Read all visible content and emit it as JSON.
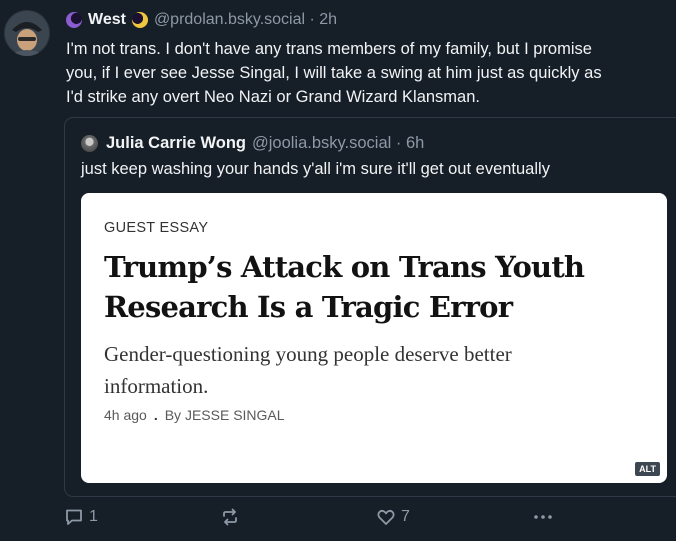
{
  "post": {
    "display_name": "West",
    "handle": "@prdolan.bsky.social",
    "time": "2h",
    "text_lines": [
      "I'm not trans. I don't have any trans members of my family, but I promise",
      "you, if I ever see Jesse Singal, I will take a swing at him just as quickly as",
      "I'd strike any overt Neo Nazi or Grand Wizard Klansman."
    ]
  },
  "quote": {
    "display_name": "Julia Carrie Wong",
    "handle": "@joolia.bsky.social",
    "time": "6h",
    "text": "just keep washing your hands y'all i'm sure it'll get out eventually"
  },
  "article": {
    "kicker": "GUEST ESSAY",
    "headline_lines": [
      "Trump’s Attack on Trans Youth",
      "Research Is a Tragic Error"
    ],
    "summary_lines": [
      "Gender-questioning young people deserve better",
      "information."
    ],
    "time": "4h ago",
    "byline": "By JESSE SINGAL",
    "alt_badge": "ALT"
  },
  "actions": {
    "reply_count": "1",
    "repost_count": "",
    "like_count": "7"
  },
  "colors": {
    "background": "#161e27",
    "text": "#f1f3f5",
    "muted": "#8d99a6",
    "border": "#2e3a47"
  }
}
